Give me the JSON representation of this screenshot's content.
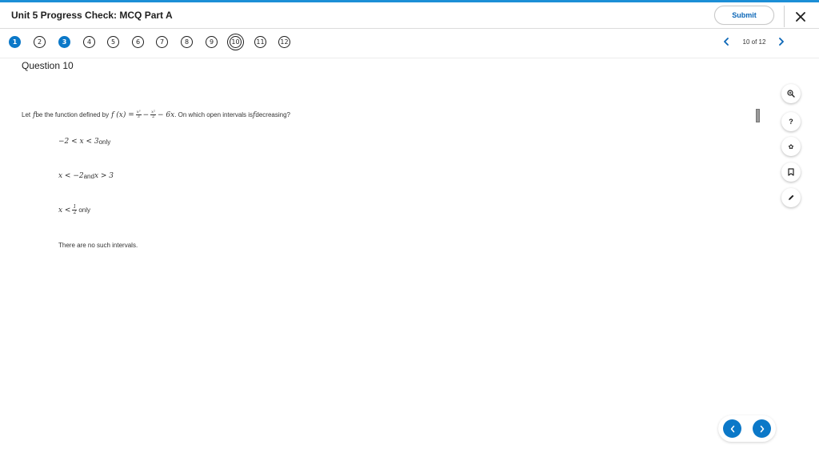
{
  "app": {
    "title": "Unit 5 Progress Check: MCQ Part A",
    "accent_color": "#1c8fd6"
  },
  "header": {
    "submit_label": "Submit",
    "close_icon": "close-icon"
  },
  "question_nav": {
    "items": [
      {
        "label": "1",
        "state": "answered"
      },
      {
        "label": "2",
        "state": "unanswered"
      },
      {
        "label": "3",
        "state": "answered"
      },
      {
        "label": "4",
        "state": "unanswered"
      },
      {
        "label": "5",
        "state": "unanswered"
      },
      {
        "label": "6",
        "state": "unanswered"
      },
      {
        "label": "7",
        "state": "unanswered"
      },
      {
        "label": "8",
        "state": "unanswered"
      },
      {
        "label": "9",
        "state": "unanswered"
      },
      {
        "label": "10",
        "state": "current"
      },
      {
        "label": "11",
        "state": "unanswered"
      },
      {
        "label": "12",
        "state": "unanswered"
      }
    ],
    "pager_text": "10 of 12",
    "answered_color": "#0b78c8"
  },
  "question": {
    "title": "Question 10",
    "stem": {
      "prefix": "Let ",
      "f": "f",
      "be_defined": " be the function defined by ",
      "fx": "f (x) =",
      "frac1_num": "x³",
      "frac1_den": "3",
      "minus": "−",
      "frac2_num": "x²",
      "frac2_den": "2",
      "term3": "− 6x",
      "suffix1": ". On which open intervals is ",
      "f2": "f",
      "suffix2": " decreasing?"
    },
    "choices": {
      "a_math": "−2 < x < 3",
      "a_text": " only",
      "b_math1": "x < −2",
      "b_text": " and ",
      "b_math2": "x > 3",
      "c_math": "x <",
      "c_num": "1",
      "c_den": "2",
      "c_text": " only",
      "d_text": "There are no such intervals."
    }
  },
  "tools": [
    {
      "icon": "zoom-in-icon",
      "glyph": "⊕"
    },
    {
      "icon": "help-icon",
      "glyph": "?"
    },
    {
      "icon": "settings-icon",
      "glyph": "✿"
    },
    {
      "icon": "bookmark-icon",
      "glyph": ""
    },
    {
      "icon": "pencil-icon",
      "glyph": "✎"
    }
  ],
  "bottom_nav": {
    "prev_icon": "chevron-left-icon",
    "next_icon": "chevron-right-icon"
  }
}
